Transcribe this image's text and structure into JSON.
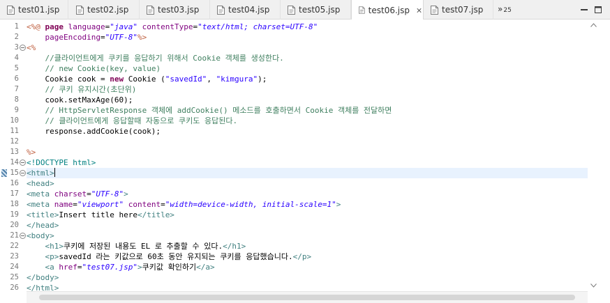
{
  "tabs": [
    {
      "label": "test01.jsp",
      "active": false
    },
    {
      "label": "test02.jsp",
      "active": false
    },
    {
      "label": "test03.jsp",
      "active": false
    },
    {
      "label": "test04.jsp",
      "active": false
    },
    {
      "label": "test05.jsp",
      "active": false
    },
    {
      "label": "test06.jsp",
      "active": true
    },
    {
      "label": "test07.jsp",
      "active": false
    }
  ],
  "overflow": {
    "glyph": "»",
    "count": "25"
  },
  "editor": {
    "current_line": 15,
    "lines": [
      {
        "n": "1",
        "tokens": [
          [
            "d",
            "<%@"
          ],
          [
            "tx",
            " "
          ],
          [
            "k",
            "page"
          ],
          [
            "tx",
            " "
          ],
          [
            "an",
            "language"
          ],
          [
            "tx",
            "="
          ],
          [
            "si",
            "\"java\""
          ],
          [
            "tx",
            " "
          ],
          [
            "an",
            "contentType"
          ],
          [
            "tx",
            "="
          ],
          [
            "si",
            "\"text/html; charset=UTF-8\""
          ]
        ]
      },
      {
        "n": "2",
        "tokens": [
          [
            "tx",
            "    "
          ],
          [
            "an",
            "pageEncoding"
          ],
          [
            "tx",
            "="
          ],
          [
            "si",
            "\"UTF-8\""
          ],
          [
            "d",
            "%>"
          ]
        ]
      },
      {
        "n": "3",
        "tokens": [
          [
            "d",
            "<%"
          ]
        ]
      },
      {
        "n": "4",
        "tokens": [
          [
            "tx",
            "    "
          ],
          [
            "c",
            "//클라이언트에게 쿠키를 응답하기 위해서 Cookie 객체를 생성한다."
          ]
        ]
      },
      {
        "n": "5",
        "tokens": [
          [
            "tx",
            "    "
          ],
          [
            "c",
            "// new Cookie(key, value)"
          ]
        ]
      },
      {
        "n": "6",
        "tokens": [
          [
            "tx",
            "    Cookie cook = "
          ],
          [
            "jk",
            "new"
          ],
          [
            "tx",
            " Cookie ("
          ],
          [
            "s",
            "\"savedId\""
          ],
          [
            "tx",
            ", "
          ],
          [
            "s",
            "\"kimgura\""
          ],
          [
            "tx",
            ");"
          ]
        ]
      },
      {
        "n": "7",
        "tokens": [
          [
            "tx",
            "    "
          ],
          [
            "c",
            "// 쿠키 유지시간(초단위)"
          ]
        ]
      },
      {
        "n": "8",
        "tokens": [
          [
            "tx",
            "    cook.setMaxAge(60);"
          ]
        ]
      },
      {
        "n": "9",
        "tokens": [
          [
            "tx",
            "    "
          ],
          [
            "c",
            "// HttpServletResponse 객체에 addCookie() 메소드를 호출하면서 Cookie 객체를 전달하면"
          ]
        ]
      },
      {
        "n": "10",
        "tokens": [
          [
            "tx",
            "    "
          ],
          [
            "c",
            "// 클라이언트에게 응답할때 자동으로 쿠키도 응답된다."
          ]
        ]
      },
      {
        "n": "11",
        "tokens": [
          [
            "tx",
            "    response.addCookie(cook);"
          ]
        ]
      },
      {
        "n": "12",
        "tokens": [
          [
            "tx",
            ""
          ]
        ]
      },
      {
        "n": "13",
        "tokens": [
          [
            "d",
            "%>"
          ]
        ]
      },
      {
        "n": "14",
        "tokens": [
          [
            "dt",
            "<!DOCTYPE html>"
          ]
        ]
      },
      {
        "n": "15",
        "tokens": [
          [
            "t",
            "<html>"
          ]
        ]
      },
      {
        "n": "16",
        "tokens": [
          [
            "t",
            "<head>"
          ]
        ]
      },
      {
        "n": "17",
        "tokens": [
          [
            "t",
            "<meta"
          ],
          [
            "tx",
            " "
          ],
          [
            "an",
            "charset"
          ],
          [
            "tx",
            "="
          ],
          [
            "si",
            "\"UTF-8\""
          ],
          [
            "t",
            ">"
          ]
        ]
      },
      {
        "n": "18",
        "tokens": [
          [
            "t",
            "<meta"
          ],
          [
            "tx",
            " "
          ],
          [
            "an",
            "name"
          ],
          [
            "tx",
            "="
          ],
          [
            "si",
            "\"viewport\""
          ],
          [
            "tx",
            " "
          ],
          [
            "an",
            "content"
          ],
          [
            "tx",
            "="
          ],
          [
            "si",
            "\"width=device-width, initial-scale=1\""
          ],
          [
            "t",
            ">"
          ]
        ]
      },
      {
        "n": "19",
        "tokens": [
          [
            "t",
            "<title>"
          ],
          [
            "tx",
            "Insert title here"
          ],
          [
            "t",
            "</title>"
          ]
        ]
      },
      {
        "n": "20",
        "tokens": [
          [
            "t",
            "</head>"
          ]
        ]
      },
      {
        "n": "21",
        "tokens": [
          [
            "t",
            "<body>"
          ]
        ]
      },
      {
        "n": "22",
        "tokens": [
          [
            "tx",
            "    "
          ],
          [
            "t",
            "<h1>"
          ],
          [
            "tx",
            "쿠키에 저장된 내용도 EL 로 추출할 수 있다."
          ],
          [
            "t",
            "</h1>"
          ]
        ]
      },
      {
        "n": "23",
        "tokens": [
          [
            "tx",
            "    "
          ],
          [
            "t",
            "<p>"
          ],
          [
            "tx",
            "savedId 라는 키값으로 60초 동안 유지되는 쿠키를 응답했습니다."
          ],
          [
            "t",
            "</p>"
          ]
        ]
      },
      {
        "n": "24",
        "tokens": [
          [
            "tx",
            "    "
          ],
          [
            "t",
            "<a"
          ],
          [
            "tx",
            " "
          ],
          [
            "an",
            "href"
          ],
          [
            "tx",
            "="
          ],
          [
            "si",
            "\"test07.jsp\""
          ],
          [
            "t",
            ">"
          ],
          [
            "tx",
            "쿠키값 확인하기"
          ],
          [
            "t",
            "</a>"
          ]
        ]
      },
      {
        "n": "25",
        "tokens": [
          [
            "t",
            "</body>"
          ]
        ]
      },
      {
        "n": "26",
        "tokens": [
          [
            "t",
            "</html>"
          ]
        ]
      }
    ]
  }
}
